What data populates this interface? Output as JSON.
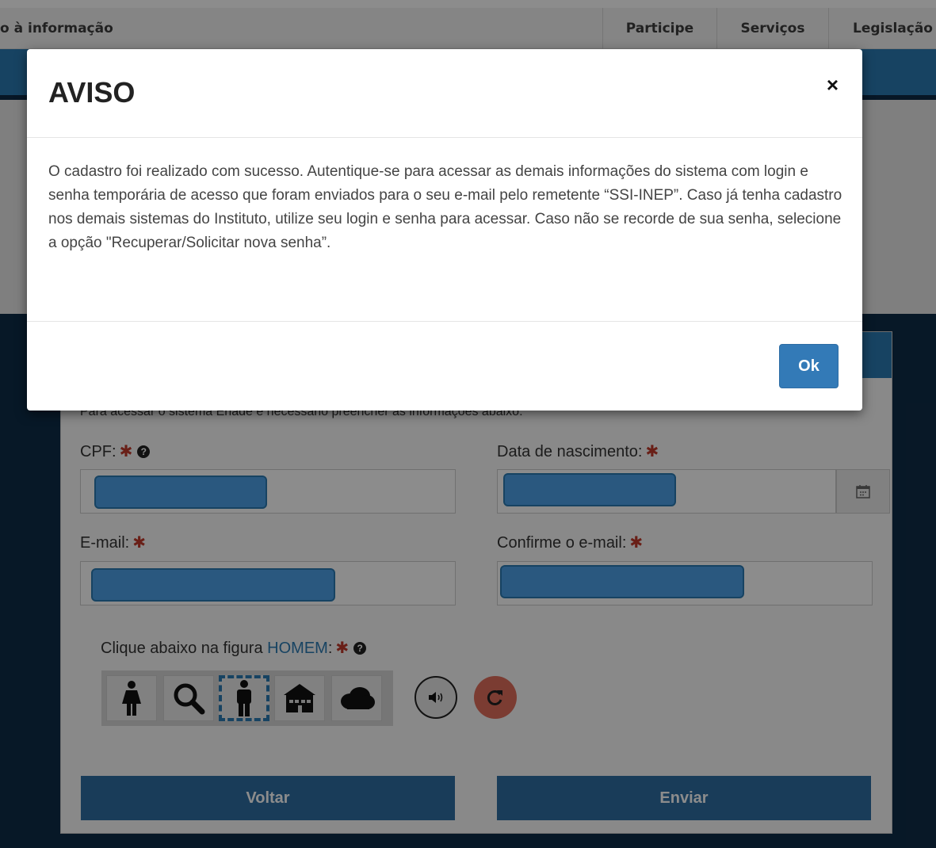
{
  "nav": {
    "brand": "o à informação",
    "items": [
      "Participe",
      "Serviços",
      "Legislação"
    ]
  },
  "form": {
    "intro": "Para acessar o sistema Enade é necessário preencher as informações abaixo:",
    "cpf_label": "CPF:",
    "birth_label": "Data de nascimento:",
    "email_label": "E-mail:",
    "confirm_email_label": "Confirme o e-mail:",
    "required_mark": "✱",
    "captcha_prompt": "Clique abaixo na figura",
    "captcha_target": "HOMEM",
    "captcha_colon": ":",
    "back_button": "Voltar",
    "submit_button": "Enviar"
  },
  "modal": {
    "title": "AVISO",
    "close": "×",
    "body": "O cadastro foi realizado com sucesso. Autentique-se para acessar as demais informações do sistema com login e senha temporária de acesso que foram enviados para o seu e-mail pelo remetente “SSI-INEP”. Caso já tenha cadastro nos demais sistemas do Instituto, utilize seu login e senha para acessar. Caso não se recorde de sua senha, selecione a opção \"Recuperar/Solicitar nova senha”.",
    "ok_button": "Ok"
  },
  "icons": {
    "captcha_options": [
      "woman-icon",
      "search-icon",
      "man-icon",
      "house-icon",
      "cloud-icon"
    ],
    "selected_option": "man-icon",
    "audio": "audio-icon",
    "refresh": "refresh-icon",
    "calendar": "calendar-icon"
  },
  "colors": {
    "primary": "#2b7ab3",
    "dark_background": "#0e2c47",
    "required": "#c0392b",
    "refresh": "#e06d5b",
    "redaction": "#4ea1e8"
  }
}
